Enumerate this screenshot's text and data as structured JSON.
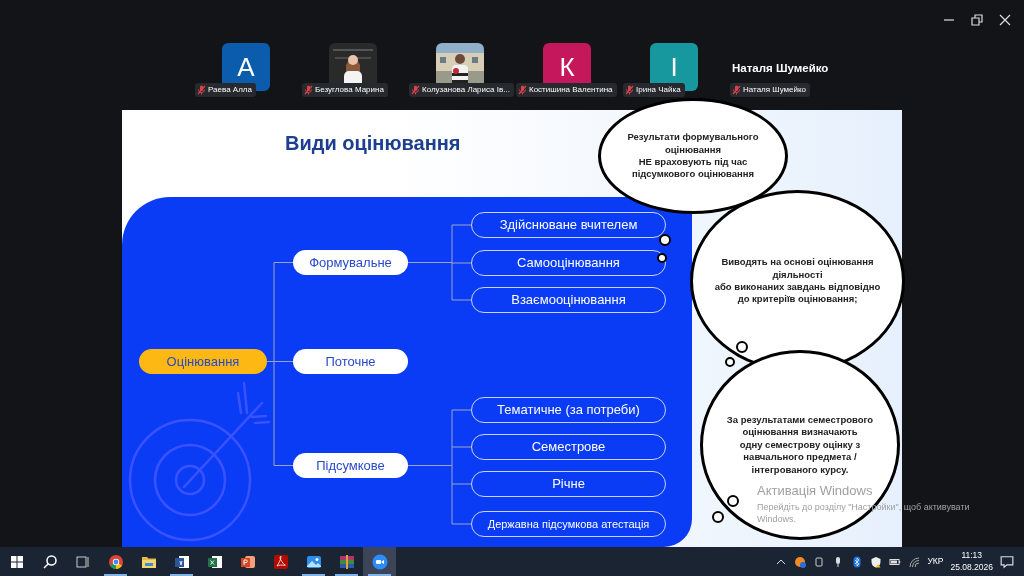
{
  "participants": [
    {
      "kind": "initial",
      "initial": "А",
      "color": "#0b5cad",
      "name": "Раева Алла",
      "muted": true
    },
    {
      "kind": "picture",
      "name": "Безуглова Марина",
      "muted": true
    },
    {
      "kind": "picture",
      "name": "Колузанова Лариса Ів...",
      "muted": true
    },
    {
      "kind": "initial",
      "initial": "К",
      "color": "#c4175c",
      "name": "Костишина Валентина",
      "muted": true
    },
    {
      "kind": "initial",
      "initial": "І",
      "color": "#17979e",
      "name": "Ірина Чайка",
      "muted": true
    },
    {
      "kind": "name",
      "title": "Наталя Шумейко",
      "name": "Наталя Шумейко",
      "muted": true
    }
  ],
  "slide": {
    "title": "Види оцінювання",
    "root": "Оцінювання",
    "branches": [
      {
        "label": "Формувальне",
        "children": [
          "Здійснюване вчителем",
          "Самооцінювання",
          "Взаємооцінювання"
        ]
      },
      {
        "label": "Поточне"
      },
      {
        "label": "Підсумкове",
        "children": [
          "Тематичне (за потреби)",
          "Семестрове",
          "Річне",
          "Державна підсумкова атестація"
        ]
      }
    ],
    "bubbles": [
      {
        "lines": [
          "Результати формувального",
          "оцінювання",
          "НЕ враховують під час",
          "підсумкового оцінювання"
        ]
      },
      {
        "lines": [
          "Виводять на основі оцінювання",
          "діяльності",
          "або виконаних завдань відповідно",
          "до критеріїв оцінювання;"
        ]
      },
      {
        "lines": [
          "За результатами семестрового",
          "оцінювання визначають",
          "одну семестрову оцінку з",
          "навчального предмета /",
          "інтегрованого курсу."
        ]
      }
    ]
  },
  "activation": {
    "title": "Активація Windows",
    "text": "Перейдіть до розділу \"Настройки\", щоб активувати Windows."
  },
  "taskbar": {
    "apps": [
      {
        "kind": "start",
        "running": false,
        "selected": false
      },
      {
        "kind": "search",
        "running": false,
        "selected": false
      },
      {
        "kind": "taskview",
        "running": false,
        "selected": false
      },
      {
        "kind": "browser",
        "running": true,
        "selected": false
      },
      {
        "kind": "folder",
        "running": false,
        "selected": false
      },
      {
        "kind": "word",
        "running": true,
        "selected": false
      },
      {
        "kind": "excel",
        "running": false,
        "selected": false
      },
      {
        "kind": "powerpoint",
        "running": false,
        "selected": false
      },
      {
        "kind": "pdf",
        "running": false,
        "selected": false
      },
      {
        "kind": "photos",
        "running": true,
        "selected": false
      },
      {
        "kind": "archive",
        "running": true,
        "selected": false
      },
      {
        "kind": "meeting",
        "running": true,
        "selected": true
      }
    ],
    "language": "УКР",
    "time": "11:13",
    "date": "25.08.2026"
  }
}
